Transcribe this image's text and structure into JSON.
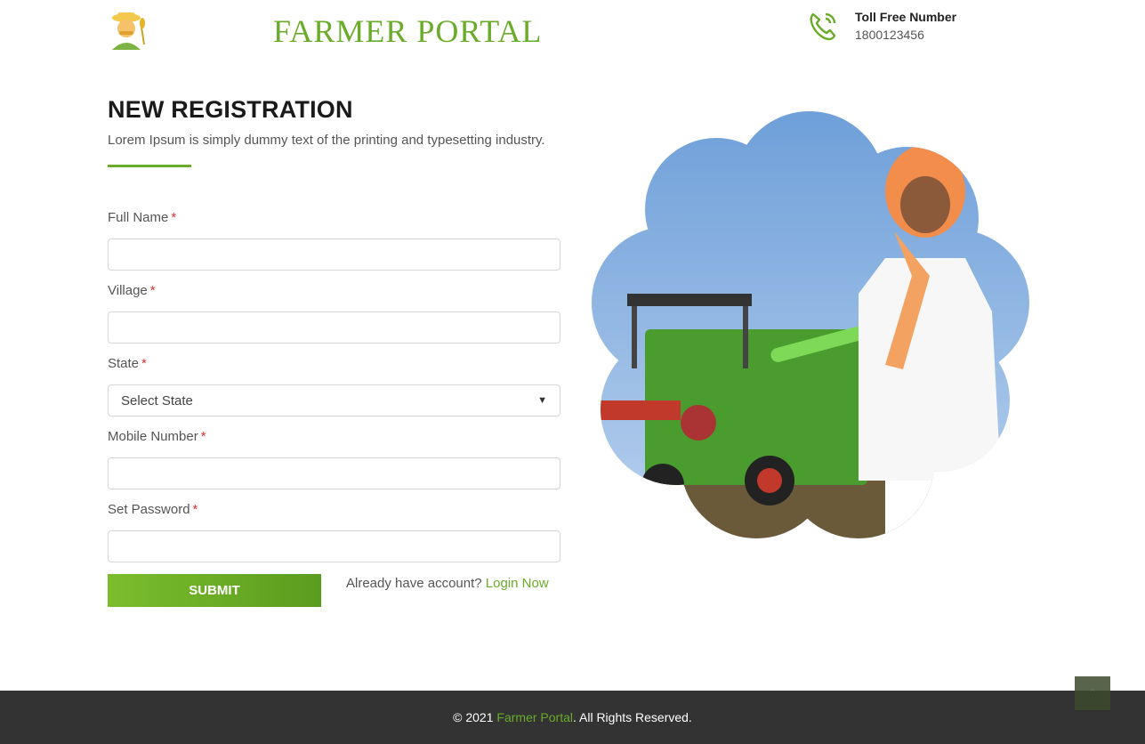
{
  "header": {
    "brand": "FARMER PORTAL",
    "toll_free_label": "Toll Free Number",
    "toll_free_number": "1800123456"
  },
  "form": {
    "title": "NEW REGISTRATION",
    "subtitle": "Lorem Ipsum is simply dummy text of the printing and typesetting industry.",
    "required_mark": "*",
    "fields": [
      {
        "label": "Full Name",
        "value": ""
      },
      {
        "label": "Village",
        "value": ""
      },
      {
        "label": "State",
        "value": "Select State"
      },
      {
        "label": "Mobile Number",
        "value": ""
      },
      {
        "label": "Set Password",
        "value": ""
      }
    ],
    "submit_label": "SUBMIT",
    "login_prompt": "Already have account?",
    "login_link": "Login Now"
  },
  "footer": {
    "prefix": "© 2021",
    "brand": "Farmer Portal",
    "suffix": ". All Rights Reserved."
  },
  "icons": {
    "logo": "farmer-emoji-icon",
    "phone": "phone-call-icon",
    "scroll_top": "chevron-up-icon",
    "select_caret": "chevron-down-icon"
  },
  "colors": {
    "accent": "#6aab2a",
    "footer_bg": "#333333",
    "required": "#dd3333"
  }
}
